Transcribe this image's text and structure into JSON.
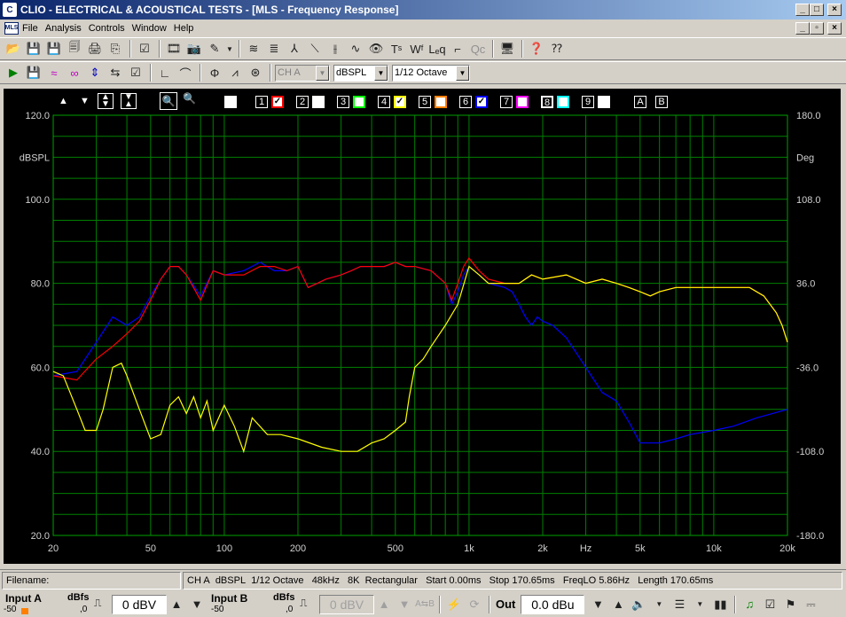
{
  "window": {
    "title": "CLIO - ELECTRICAL & ACOUSTICAL TESTS - [MLS - Frequency Response]",
    "logo": "C",
    "controls": [
      "_",
      "□",
      "×"
    ],
    "mdi_controls": [
      "_",
      "▫",
      "×"
    ]
  },
  "menu": {
    "mdi_icon": "MLS",
    "items": [
      "File",
      "Analysis",
      "Controls",
      "Window",
      "Help"
    ]
  },
  "toolbar2": {
    "channel": "CH A",
    "units": "dBSPL",
    "smoothing": "1/12 Octave"
  },
  "plot_controls": {
    "channels": [
      "1",
      "2",
      "3",
      "4",
      "5",
      "6",
      "7",
      "8",
      "9"
    ],
    "refs": [
      "A",
      "B"
    ],
    "channel_colors": [
      "#ff0000",
      "#ffffff",
      "#00ff00",
      "#ffff00",
      "#ff8000",
      "#0000ff",
      "#ff00ff",
      "#00ffff",
      "#ffffff"
    ],
    "checked": [
      true,
      false,
      false,
      true,
      false,
      true,
      false,
      false,
      false
    ]
  },
  "chart_data": {
    "type": "line",
    "ylabel": "dBSPL",
    "y2label": "Deg",
    "xlabel": "Hz",
    "ylim": [
      20,
      120
    ],
    "y2lim": [
      -180,
      180
    ],
    "xlim": [
      20,
      20000
    ],
    "xscale": "log",
    "grid": true,
    "y_ticks": [
      "120.0",
      "100.0",
      "80.0",
      "60.0",
      "40.0",
      "20.0"
    ],
    "y2_ticks": [
      "180.0",
      "108.0",
      "36.0",
      "-36.0",
      "-108.0",
      "-180.0"
    ],
    "x_ticks": [
      "20",
      "50",
      "100",
      "200",
      "500",
      "1k",
      "2k",
      "Hz",
      "5k",
      "10k",
      "20k"
    ],
    "series": [
      {
        "color": "#0000ff",
        "points": [
          [
            20,
            58
          ],
          [
            25,
            59
          ],
          [
            30,
            66
          ],
          [
            35,
            72
          ],
          [
            40,
            70
          ],
          [
            45,
            72
          ],
          [
            50,
            77
          ],
          [
            55,
            81
          ],
          [
            60,
            84
          ],
          [
            65,
            84
          ],
          [
            70,
            82
          ],
          [
            80,
            77
          ],
          [
            90,
            83
          ],
          [
            100,
            82
          ],
          [
            120,
            83
          ],
          [
            140,
            85
          ],
          [
            160,
            83
          ],
          [
            180,
            83
          ],
          [
            200,
            84
          ],
          [
            220,
            79
          ],
          [
            240,
            80
          ],
          [
            260,
            81
          ],
          [
            300,
            82
          ],
          [
            330,
            83
          ],
          [
            360,
            84
          ],
          [
            400,
            84
          ],
          [
            450,
            84
          ],
          [
            500,
            85
          ],
          [
            550,
            84
          ],
          [
            600,
            84
          ],
          [
            700,
            83
          ],
          [
            800,
            80
          ],
          [
            850,
            75
          ],
          [
            900,
            78
          ],
          [
            950,
            82
          ],
          [
            1000,
            84
          ],
          [
            1100,
            82
          ],
          [
            1200,
            80
          ],
          [
            1400,
            79
          ],
          [
            1500,
            78
          ],
          [
            1600,
            75
          ],
          [
            1700,
            72
          ],
          [
            1800,
            70
          ],
          [
            1900,
            72
          ],
          [
            2000,
            71
          ],
          [
            2200,
            70
          ],
          [
            2500,
            67
          ],
          [
            3000,
            60
          ],
          [
            3500,
            54
          ],
          [
            4000,
            52
          ],
          [
            4500,
            47
          ],
          [
            5000,
            42
          ],
          [
            6000,
            42
          ],
          [
            7000,
            43
          ],
          [
            8000,
            44
          ],
          [
            10000,
            45
          ],
          [
            12000,
            46
          ],
          [
            15000,
            48
          ],
          [
            20000,
            50
          ]
        ]
      },
      {
        "color": "#ff0000",
        "points": [
          [
            20,
            58
          ],
          [
            25,
            57
          ],
          [
            30,
            62
          ],
          [
            35,
            65
          ],
          [
            40,
            68
          ],
          [
            45,
            71
          ],
          [
            50,
            76
          ],
          [
            55,
            81
          ],
          [
            60,
            84
          ],
          [
            65,
            84
          ],
          [
            70,
            82
          ],
          [
            80,
            76
          ],
          [
            90,
            83
          ],
          [
            100,
            82
          ],
          [
            120,
            82
          ],
          [
            140,
            84
          ],
          [
            160,
            84
          ],
          [
            180,
            83
          ],
          [
            200,
            84
          ],
          [
            220,
            79
          ],
          [
            240,
            80
          ],
          [
            260,
            81
          ],
          [
            300,
            82
          ],
          [
            330,
            83
          ],
          [
            360,
            84
          ],
          [
            400,
            84
          ],
          [
            450,
            84
          ],
          [
            500,
            85
          ],
          [
            550,
            84
          ],
          [
            600,
            84
          ],
          [
            700,
            83
          ],
          [
            800,
            80
          ],
          [
            850,
            76
          ],
          [
            900,
            80
          ],
          [
            950,
            84
          ],
          [
            1000,
            86
          ],
          [
            1100,
            83
          ],
          [
            1200,
            81
          ],
          [
            1400,
            80
          ],
          [
            1600,
            80
          ],
          [
            1800,
            82
          ],
          [
            2000,
            81
          ],
          [
            2500,
            82
          ],
          [
            3000,
            80
          ],
          [
            3500,
            81
          ],
          [
            4000,
            80
          ],
          [
            4500,
            79
          ],
          [
            5000,
            78
          ],
          [
            5500,
            77
          ],
          [
            6000,
            78
          ],
          [
            7000,
            79
          ],
          [
            8000,
            79
          ],
          [
            10000,
            79
          ],
          [
            12000,
            79
          ],
          [
            14000,
            79
          ],
          [
            16000,
            77
          ],
          [
            18000,
            73
          ],
          [
            19000,
            70
          ],
          [
            20000,
            66
          ]
        ]
      },
      {
        "color": "#ffff00",
        "points": [
          [
            20,
            59
          ],
          [
            22,
            58
          ],
          [
            25,
            50
          ],
          [
            27,
            45
          ],
          [
            30,
            45
          ],
          [
            32,
            50
          ],
          [
            35,
            60
          ],
          [
            38,
            61
          ],
          [
            40,
            58
          ],
          [
            45,
            50
          ],
          [
            50,
            43
          ],
          [
            55,
            44
          ],
          [
            60,
            51
          ],
          [
            65,
            53
          ],
          [
            70,
            49
          ],
          [
            75,
            53
          ],
          [
            80,
            48
          ],
          [
            85,
            52
          ],
          [
            90,
            45
          ],
          [
            100,
            51
          ],
          [
            110,
            46
          ],
          [
            120,
            40
          ],
          [
            130,
            48
          ],
          [
            150,
            44
          ],
          [
            170,
            44
          ],
          [
            200,
            43
          ],
          [
            250,
            41
          ],
          [
            300,
            40
          ],
          [
            350,
            40
          ],
          [
            400,
            42
          ],
          [
            450,
            43
          ],
          [
            500,
            45
          ],
          [
            550,
            47
          ],
          [
            570,
            53
          ],
          [
            600,
            60
          ],
          [
            650,
            62
          ],
          [
            700,
            65
          ],
          [
            800,
            70
          ],
          [
            900,
            75
          ],
          [
            1000,
            84
          ],
          [
            1100,
            82
          ],
          [
            1200,
            80
          ],
          [
            1400,
            80
          ],
          [
            1600,
            80
          ],
          [
            1800,
            82
          ],
          [
            2000,
            81
          ],
          [
            2500,
            82
          ],
          [
            3000,
            80
          ],
          [
            3500,
            81
          ],
          [
            4000,
            80
          ],
          [
            4500,
            79
          ],
          [
            5000,
            78
          ],
          [
            5500,
            77
          ],
          [
            6000,
            78
          ],
          [
            7000,
            79
          ],
          [
            8000,
            79
          ],
          [
            10000,
            79
          ],
          [
            12000,
            79
          ],
          [
            14000,
            79
          ],
          [
            16000,
            77
          ],
          [
            18000,
            73
          ],
          [
            19000,
            70
          ],
          [
            20000,
            66
          ]
        ]
      }
    ]
  },
  "status": {
    "filename_label": "Filename:",
    "filename_value": "",
    "items": [
      "CH A",
      "dBSPL",
      "1/12 Octave",
      "48kHz",
      "8K",
      "Rectangular",
      "Start 0.00ms",
      "Stop 170.65ms",
      "FreqLO 5.86Hz",
      "Length 170.65ms"
    ]
  },
  "bottom": {
    "input_a_label": "Input A",
    "input_a_scale_lo": "-50",
    "input_a_dbfs": "dBfs",
    "input_a_scale_hi": ",0",
    "input_a_value": "0 dBV",
    "input_b_label": "Input B",
    "input_b_scale_lo": "-50",
    "input_b_dbfs": "dBfs",
    "input_b_scale_hi": ",0",
    "input_b_value": "0 dBV",
    "out_label": "Out",
    "out_value": "0.0 dBu"
  }
}
